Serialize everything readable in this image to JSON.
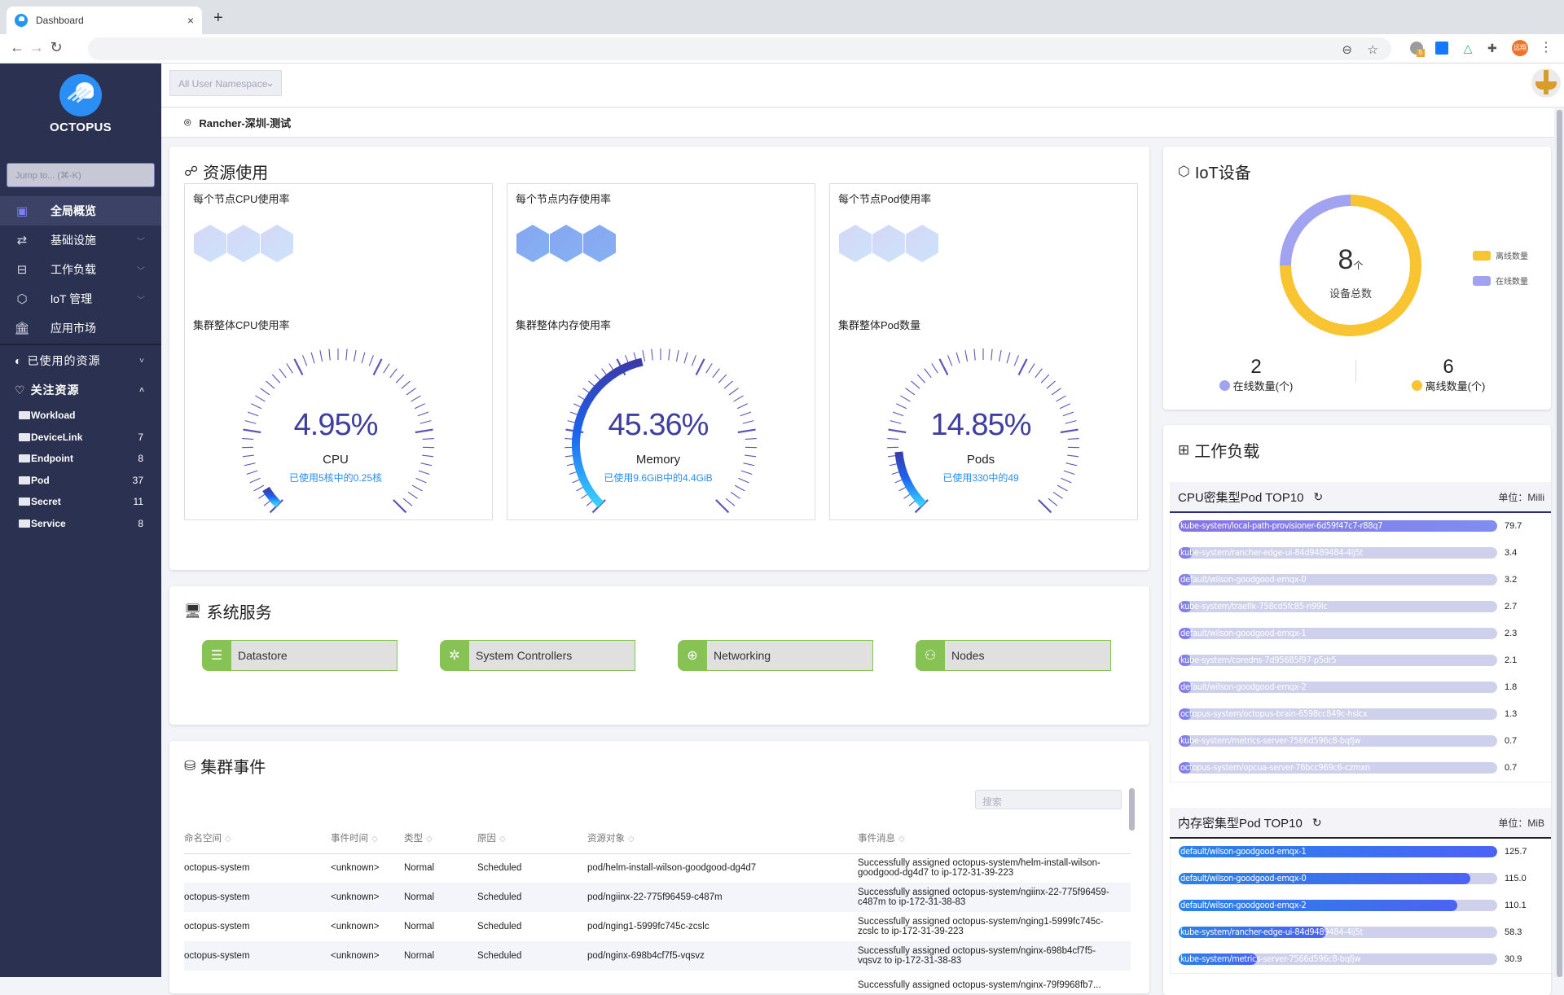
{
  "browser": {
    "tab_title": "Dashboard",
    "tab_close": "×",
    "new_tab": "+",
    "back": "←",
    "forward": "→",
    "reload": "↻",
    "extension_badge": "5",
    "profile_label": "远翔"
  },
  "sidebar": {
    "brand": "OCTOPUS",
    "jump_placeholder": "Jump to... (⌘-K)",
    "menu": [
      {
        "label": "全局概览",
        "icon": "grid-icon",
        "active": true
      },
      {
        "label": "基础设施",
        "icon": "infrastructure-icon",
        "chevron": true
      },
      {
        "label": "工作负载",
        "icon": "briefcase-icon",
        "chevron": true
      },
      {
        "label": "loT 管理",
        "icon": "iot-icon",
        "chevron": true
      },
      {
        "label": "应用市场",
        "icon": "bank-icon"
      }
    ],
    "used_resources": {
      "label": "已使用的资源",
      "expanded": false
    },
    "favorites": {
      "label": "关注资源",
      "expanded": true,
      "items": [
        {
          "name": "Workload",
          "count": ""
        },
        {
          "name": "DeviceLink",
          "count": "7"
        },
        {
          "name": "Endpoint",
          "count": "8"
        },
        {
          "name": "Pod",
          "count": "37"
        },
        {
          "name": "Secret",
          "count": "11"
        },
        {
          "name": "Service",
          "count": "8"
        }
      ]
    }
  },
  "header": {
    "namespace_select": "All User Namespace",
    "cluster_name": "Rancher-深圳-测试"
  },
  "resource_usage": {
    "title": "资源使用",
    "panels": [
      {
        "node_title": "每个节点CPU使用率",
        "node_hex_count": 3,
        "node_hex_level": "light",
        "cluster_title": "集群整体CPU使用率",
        "percent_label": "4.95%",
        "percent": 4.95,
        "name": "CPU",
        "desc": "已使用5核中的0.25核"
      },
      {
        "node_title": "每个节点内存使用率",
        "node_hex_count": 3,
        "node_hex_level": "mid",
        "cluster_title": "集群整体内存使用率",
        "percent_label": "45.36%",
        "percent": 45.36,
        "name": "Memory",
        "desc": "已使用9.6GiB中的4.4GiB"
      },
      {
        "node_title": "每个节点Pod使用率",
        "node_hex_count": 3,
        "node_hex_level": "light",
        "cluster_title": "集群整体Pod数量",
        "percent_label": "14.85%",
        "percent": 14.85,
        "name": "Pods",
        "desc": "已使用330中的49"
      }
    ]
  },
  "system_services": {
    "title": "系统服务",
    "items": [
      {
        "label": "Datastore",
        "icon": "database-icon"
      },
      {
        "label": "System Controllers",
        "icon": "gear-icon"
      },
      {
        "label": "Networking",
        "icon": "globe-icon"
      },
      {
        "label": "Nodes",
        "icon": "nodes-icon"
      }
    ]
  },
  "cluster_events": {
    "title": "集群事件",
    "search_placeholder": "搜索",
    "columns": [
      "命名空间",
      "事件时间",
      "类型",
      "原因",
      "资源对象",
      "事件消息"
    ],
    "rows": [
      {
        "namespace": "octopus-system",
        "time": "<unknown>",
        "type": "Normal",
        "reason": "Scheduled",
        "object": "pod/helm-install-wilson-goodgood-dg4d7",
        "message": "Successfully assigned octopus-system/helm-install-wilson-goodgood-dg4d7 to ip-172-31-39-223"
      },
      {
        "namespace": "octopus-system",
        "time": "<unknown>",
        "type": "Normal",
        "reason": "Scheduled",
        "object": "pod/ngiinx-22-775f96459-c487m",
        "message": "Successfully assigned octopus-system/ngiinx-22-775f96459-c487m to ip-172-31-38-83"
      },
      {
        "namespace": "octopus-system",
        "time": "<unknown>",
        "type": "Normal",
        "reason": "Scheduled",
        "object": "pod/nging1-5999fc745c-zcslc",
        "message": "Successfully assigned octopus-system/nging1-5999fc745c-zcslc to ip-172-31-39-223"
      },
      {
        "namespace": "octopus-system",
        "time": "<unknown>",
        "type": "Normal",
        "reason": "Scheduled",
        "object": "pod/nginx-698b4cf7f5-vqsvz",
        "message": "Successfully assigned octopus-system/nginx-698b4cf7f5-vqsvz to ip-172-31-38-83"
      },
      {
        "namespace": "",
        "time": "",
        "type": "",
        "reason": "",
        "object": "",
        "message": "Successfully assigned octopus-system/nginx-79f9968fb7..."
      }
    ]
  },
  "iot": {
    "title": "IoT设备",
    "total": "8",
    "total_unit": "个",
    "total_caption": "设备总数",
    "online": 2,
    "offline": 6,
    "online_label": "在线数量(个)",
    "offline_label": "离线数量(个)",
    "legend": [
      {
        "label": "离线数量",
        "color": "#f8c431"
      },
      {
        "label": "在线数量",
        "color": "#a1a3f0"
      }
    ],
    "colors": {
      "online": "#a1a3f0",
      "offline": "#f8c431"
    }
  },
  "workload": {
    "title": "工作负载",
    "cpu_top": {
      "title": "CPU密集型Pod TOP10",
      "unit": "单位：Milli",
      "max": 79.7,
      "items": [
        {
          "name": "kube-system/local-path-provisioner-6d59f47c7-r88q7",
          "value": 79.7
        },
        {
          "name": "kube-system/rancher-edge-ui-84d9489484-4lj5t",
          "value": 3.4
        },
        {
          "name": "default/wilson-goodgood-emqx-0",
          "value": 3.2
        },
        {
          "name": "kube-system/traefik-758cd5fc85-n99lc",
          "value": 2.7
        },
        {
          "name": "default/wilson-goodgood-emqx-1",
          "value": 2.3
        },
        {
          "name": "kube-system/coredns-7d95685f97-p5dr5",
          "value": 2.1
        },
        {
          "name": "default/wilson-goodgood-emqx-2",
          "value": 1.8
        },
        {
          "name": "octopus-system/octopus-brain-6598cc849c-hslcx",
          "value": 1.3
        },
        {
          "name": "kube-system/metrics-server-7566d596c8-bqfjw",
          "value": 0.7
        },
        {
          "name": "octopus-system/opcua-server-76bcc969c6-czmxn",
          "value": 0.7
        }
      ]
    },
    "mem_top": {
      "title": "内存密集型Pod TOP10",
      "unit": "单位：MiB",
      "max": 125.7,
      "items": [
        {
          "name": "default/wilson-goodgood-emqx-1",
          "value": 125.7
        },
        {
          "name": "default/wilson-goodgood-emqx-0",
          "value": 115.0
        },
        {
          "name": "default/wilson-goodgood-emqx-2",
          "value": 110.1
        },
        {
          "name": "kube-system/rancher-edge-ui-84d9489484-4lj5t",
          "value": 58.3
        },
        {
          "name": "kube-system/metrics-server-7566d596c8-bqfjw",
          "value": 30.9
        }
      ]
    }
  }
}
